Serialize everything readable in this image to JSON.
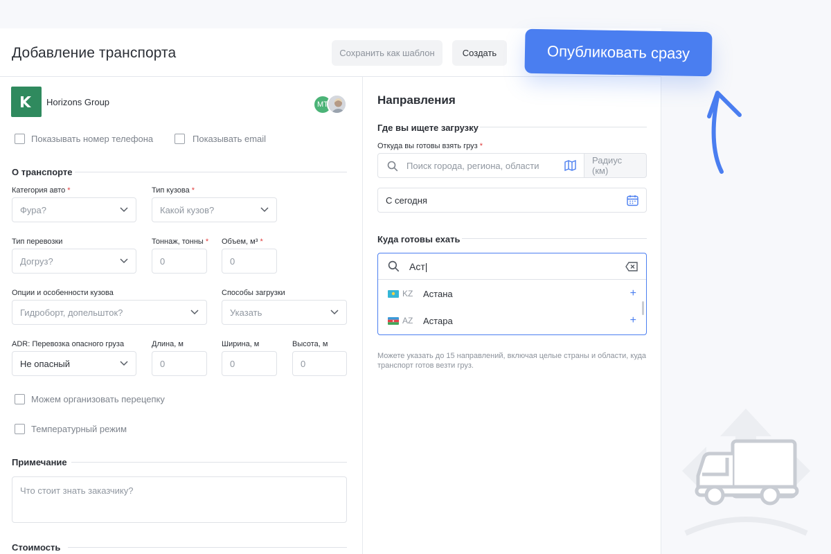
{
  "header": {
    "title": "Добавление транспорта",
    "save_template": "Сохранить как шаблон",
    "create": "Создать",
    "publish": "Опубликовать сразу"
  },
  "company": {
    "name": "Horizons Group",
    "avatar_initials": "MT"
  },
  "checkboxes": {
    "show_phone": "Показывать номер телефона",
    "show_email": "Показывать email",
    "reload": "Можем организовать перецепку",
    "temperature": "Температурный режим"
  },
  "transport": {
    "section": "О транспорте",
    "category_label": "Категория авто",
    "category_value": "Фура?",
    "body_label": "Тип кузова",
    "body_value": "Какой кузов?",
    "transport_type_label": "Тип перевозки",
    "transport_type_value": "Догруз?",
    "tonnage_label": "Тоннаж, тонны",
    "tonnage_value": "0",
    "volume_label": "Объем, м³",
    "volume_value": "0",
    "options_label": "Опции и особенности кузова",
    "options_value": "Гидроборт, допельшток?",
    "loading_label": "Способы загрузки",
    "loading_value": "Указать",
    "adr_label": "ADR: Перевозка опасного груза",
    "adr_value": "Не опасный",
    "length_label": "Длина, м",
    "length_value": "0",
    "width_label": "Ширина, м",
    "width_value": "0",
    "height_label": "Высота, м",
    "height_value": "0",
    "required_mark": "*"
  },
  "note": {
    "section": "Примечание",
    "placeholder": "Что стоит знать заказчику?"
  },
  "cost": {
    "section": "Стоимость"
  },
  "directions": {
    "title": "Направления",
    "search_section": "Где вы ищете загрузку",
    "from_label": "Откуда вы готовы взять груз",
    "from_placeholder": "Поиск города, региона, области",
    "radius_placeholder": "Радиус (км)",
    "date_value": "С сегодня",
    "to_section": "Куда готовы ехать",
    "to_query": "Аст|",
    "suggestions": [
      {
        "code": "KZ",
        "city": "Астана"
      },
      {
        "code": "AZ",
        "city": "Астара"
      }
    ],
    "hint": "Можете указать до 15 направлений, включая целые страны и области, куда транспорт готов везти груз."
  },
  "colors": {
    "accent": "#4a7ef0",
    "brand_green": "#2f8a5e",
    "required": "#e03b3b"
  }
}
